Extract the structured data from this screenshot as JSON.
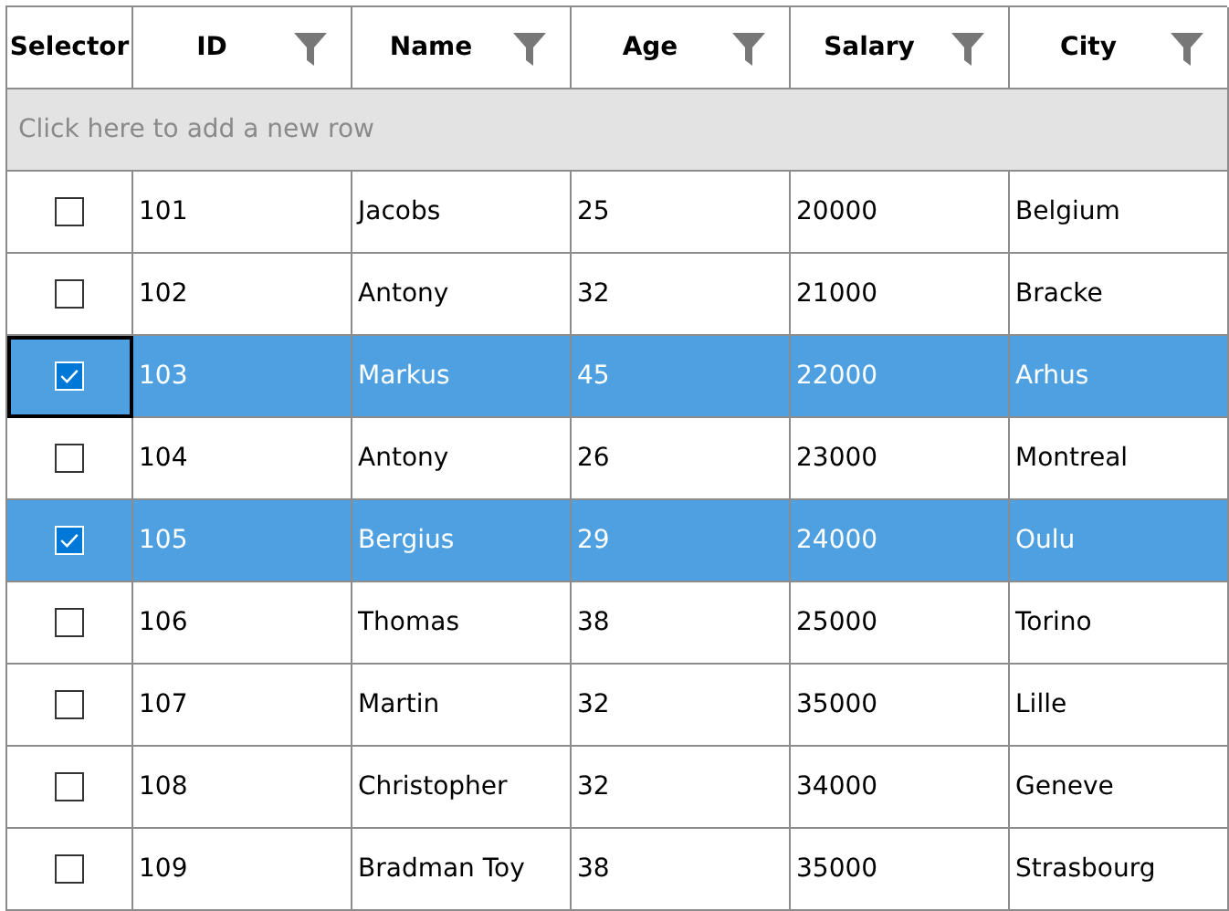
{
  "columns": [
    {
      "label": "Selector",
      "filter": false
    },
    {
      "label": "ID",
      "filter": true
    },
    {
      "label": "Name",
      "filter": true
    },
    {
      "label": "Age",
      "filter": true
    },
    {
      "label": "Salary",
      "filter": true
    },
    {
      "label": "City",
      "filter": true
    }
  ],
  "add_row": {
    "placeholder": "Click here to add a new row"
  },
  "rows": [
    {
      "checked": false,
      "selected": false,
      "focused": false,
      "cells": [
        "101",
        "Jacobs",
        "25",
        "20000",
        "Belgium"
      ]
    },
    {
      "checked": false,
      "selected": false,
      "focused": false,
      "cells": [
        "102",
        "Antony",
        "32",
        "21000",
        "Bracke"
      ]
    },
    {
      "checked": true,
      "selected": true,
      "focused": true,
      "cells": [
        "103",
        "Markus",
        "45",
        "22000",
        "Arhus"
      ]
    },
    {
      "checked": false,
      "selected": false,
      "focused": false,
      "cells": [
        "104",
        "Antony",
        "26",
        "23000",
        "Montreal"
      ]
    },
    {
      "checked": true,
      "selected": true,
      "focused": false,
      "cells": [
        "105",
        "Bergius",
        "29",
        "24000",
        "Oulu"
      ]
    },
    {
      "checked": false,
      "selected": false,
      "focused": false,
      "cells": [
        "106",
        "Thomas",
        "38",
        "25000",
        "Torino"
      ]
    },
    {
      "checked": false,
      "selected": false,
      "focused": false,
      "cells": [
        "107",
        "Martin",
        "32",
        "35000",
        "Lille"
      ]
    },
    {
      "checked": false,
      "selected": false,
      "focused": false,
      "cells": [
        "108",
        "Christopher",
        "32",
        "34000",
        "Geneve"
      ]
    },
    {
      "checked": false,
      "selected": false,
      "focused": false,
      "cells": [
        "109",
        "Bradman Toy",
        "38",
        "35000",
        "Strasbourg"
      ]
    }
  ]
}
